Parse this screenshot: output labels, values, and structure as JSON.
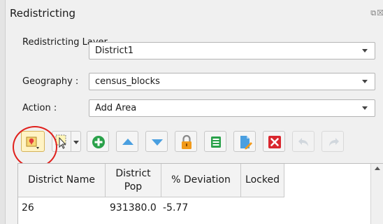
{
  "panel": {
    "title": "Redistricting",
    "title_controls": "⧉☒"
  },
  "form": {
    "layer": {
      "label": "Redistricting Layer",
      "value": "District1"
    },
    "geography": {
      "label": "Geography :",
      "value": "census_blocks"
    },
    "action": {
      "label": "Action :",
      "value": "Add Area"
    }
  },
  "toolbar": {
    "buttons": [
      {
        "icon": "map-pin-pointer-icon",
        "active": true
      },
      {
        "icon": "select-features-icon"
      },
      {
        "icon": "add-district-icon"
      },
      {
        "icon": "move-up-icon"
      },
      {
        "icon": "move-down-icon"
      },
      {
        "icon": "lock-icon"
      },
      {
        "icon": "attribute-table-icon"
      },
      {
        "icon": "edit-document-icon"
      },
      {
        "icon": "delete-icon"
      },
      {
        "icon": "undo-icon",
        "disabled": true
      },
      {
        "icon": "redo-icon",
        "disabled": true
      }
    ]
  },
  "table": {
    "columns": [
      "District Name",
      "District Pop",
      "% Deviation",
      "Locked"
    ],
    "rows": [
      {
        "district_name": "26",
        "district_pop": "931380.0",
        "deviation": "-5.77",
        "locked": ""
      }
    ]
  },
  "colors": {
    "accent_blue": "#4a9fe0",
    "green": "#2aa14a",
    "orange": "#f19a1b",
    "red": "#d9272e",
    "highlight_circle": "#e0201c"
  }
}
